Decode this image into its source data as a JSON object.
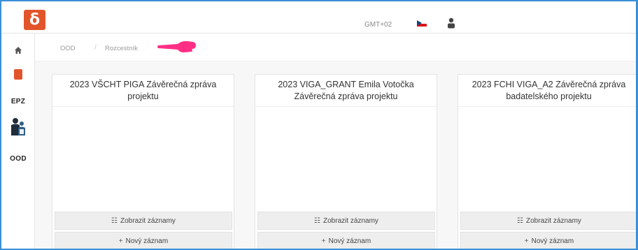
{
  "header": {
    "logo_glyph": "δ",
    "timezone": "GMT+02",
    "language_flag": "cz-flag-icon",
    "user_icon": "user-icon"
  },
  "sidebar": {
    "items": [
      {
        "icon": "home-icon"
      },
      {
        "icon": "red-document-icon"
      },
      {
        "label": "EPZ"
      },
      {
        "icon": "people-icon"
      },
      {
        "label": "OOD"
      }
    ]
  },
  "breadcrumb": {
    "items": [
      "OOD",
      "Rozcestník"
    ]
  },
  "cards": [
    {
      "title": "2023 VŠCHT PIGA Závěrečná zpráva projektu",
      "show_records": "Zobrazit záznamy",
      "new_record": "Nový záznam"
    },
    {
      "title": "2023 VIGA_GRANT Emila Votočka Závěrečná zpráva projektu",
      "show_records": "Zobrazit záznamy",
      "new_record": "Nový záznam"
    },
    {
      "title": "2023 FCHI VIGA_A2 Závěrečná zpráva badatelského projektu",
      "show_records": "Zobrazit záznamy",
      "new_record": "Nový záznam"
    }
  ],
  "colors": {
    "brand": "#e2552b",
    "pointer": "#ff2f86",
    "frame": "#3a8fd6"
  }
}
